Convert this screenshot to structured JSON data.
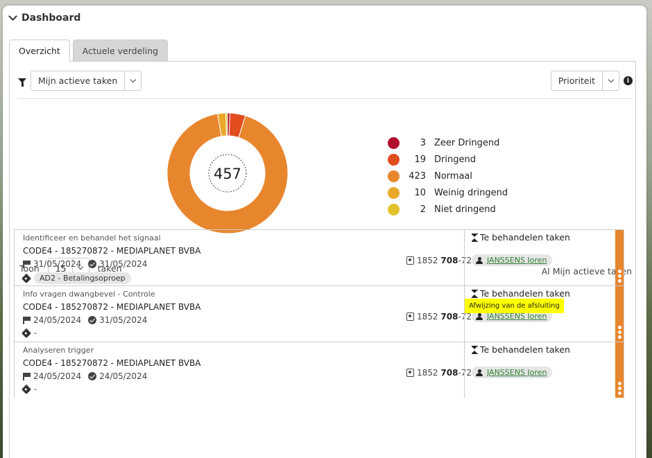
{
  "header": {
    "title": "Dashboard"
  },
  "tabs": [
    {
      "label": "Overzicht",
      "active": true
    },
    {
      "label": "Actuele verdeling",
      "active": false
    }
  ],
  "filter": {
    "selected": "Mijn actieve taken"
  },
  "sort": {
    "selected": "Prioriteit"
  },
  "chart_data": {
    "type": "pie",
    "total": "457",
    "categories": [
      "Zeer Dringend",
      "Dringend",
      "Normaal",
      "Weinig dringend",
      "Niet dringend"
    ],
    "values": [
      3,
      19,
      423,
      10,
      2
    ],
    "colors": [
      "#b0102b",
      "#e24d1e",
      "#e8862e",
      "#e9a82a",
      "#e4c22d"
    ]
  },
  "pagination": {
    "show_label": "Toon",
    "page_size": "15",
    "unit_label": "taken"
  },
  "list_scope": "Al Mijn actieve taken",
  "tasks": [
    {
      "title": "Identificeer en behandel het signaal",
      "code": "CODE4 - 185270872 - MEDIAPLANET BVBA",
      "due_date": "31/05/2024",
      "done_date": "31/05/2024",
      "tag": "AD2 - Betalingsoproep",
      "dossier_prefix": "1852",
      "dossier_bold": "708",
      "dossier_suffix": "-72",
      "status": "Te behandelen taken",
      "assignee": "JANSSENS Joren",
      "tooltip": ""
    },
    {
      "title": "Info vragen dwangbevel - Controle",
      "code": "CODE4 - 185270872 - MEDIAPLANET BVBA",
      "due_date": "24/05/2024",
      "done_date": "31/05/2024",
      "tag": "-",
      "dossier_prefix": "1852",
      "dossier_bold": "708",
      "dossier_suffix": "-72",
      "status": "Te behandelen taken",
      "assignee": "JANSSENS Joren",
      "tooltip": "Afwijzing van de afsluiting"
    },
    {
      "title": "Analyseren trigger",
      "code": "CODE4 - 185270872 - MEDIAPLANET BVBA",
      "due_date": "24/05/2024",
      "done_date": "24/05/2024",
      "tag": "-",
      "dossier_prefix": "1852",
      "dossier_bold": "708",
      "dossier_suffix": "-72",
      "status": "Te behandelen taken",
      "assignee": "JANSSENS Joren",
      "tooltip": ""
    }
  ]
}
